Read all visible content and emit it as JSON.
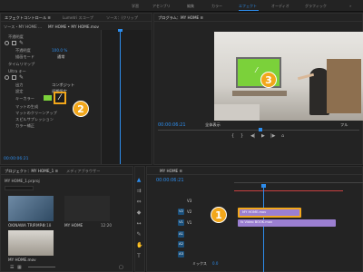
{
  "workspace_tabs": [
    "学習",
    "アセンブリ",
    "編集",
    "カラー",
    "エフェクト",
    "オーディオ",
    "グラフィック"
  ],
  "workspace_active": "エフェクト",
  "effect_controls": {
    "tabs": [
      "エフェクトコントロール ≡",
      "Lumetri スコープ",
      "ソース：(クリップ"
    ],
    "source_label": "ソース・MY HOME ...",
    "clip_label": "MY HOME • MY HOME.mov",
    "section_opacity": "不透明度",
    "opacity_label": "不透明度",
    "opacity_value": "100.0 %",
    "blend_label": "描画モード",
    "blend_value": "通常",
    "time_remap": "タイムリマップ",
    "ultra_key": "Ultra キー",
    "output_label": "出力",
    "output_value": "コンポジット",
    "setting_label": "設定",
    "setting_value": "初期設定",
    "key_color_label": "キーカラー",
    "matte_gen": "マットの生成",
    "matte_cleanup": "マットのクリーンアップ",
    "spill": "スピルサプレッション",
    "color_correct": "カラー補正",
    "timecode": "00:00:06:21"
  },
  "program": {
    "title": "プログラム：MY HOME ≡",
    "timecode": "00:00:06:21",
    "fit": "全体表示",
    "full": "フル"
  },
  "project": {
    "tabs": [
      "プロジェクト：MY HOME_1 ≡",
      "メディアブラウザー"
    ],
    "filename": "MY HOME_1.prproj",
    "items": [
      {
        "name": "OKINAWA TRIP.MP4",
        "duration": "9:18"
      },
      {
        "name": "MY HOME",
        "duration": "12:20"
      },
      {
        "name": "MY HOME.mov",
        "duration": ""
      }
    ]
  },
  "timeline": {
    "title": "MY HOME ≡",
    "timecode": "00:00:06:21",
    "video_tracks": [
      "V3",
      "V2",
      "V1"
    ],
    "audio_tracks": [
      "A1",
      "A2",
      "A3"
    ],
    "mix_label": "ミックス",
    "mix_value": "0.0",
    "clip_v2": "MY HOME.mov",
    "clip_v1": "fx Video BOOK.mov"
  },
  "callouts": [
    "1",
    "2",
    "3"
  ],
  "colors": {
    "accent": "#2d8ceb",
    "callout": "#f2a71b",
    "green_screen": "#7bd13a",
    "clip_purple": "#9b7fd1"
  }
}
